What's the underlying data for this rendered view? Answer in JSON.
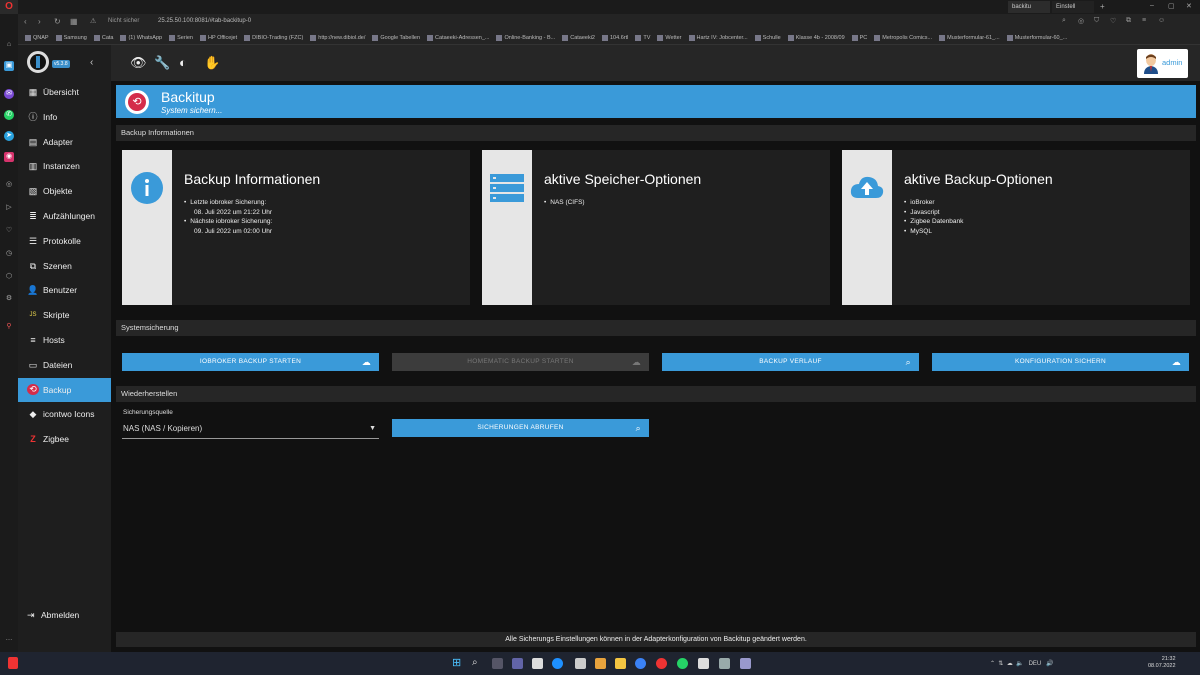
{
  "browser": {
    "tabs": [
      "backitu",
      "Einstell"
    ],
    "url_warning": "Nicht sicher",
    "url": "25.25.50.100:8081/#tab-backitup-0",
    "bookmarks": [
      "QNAP",
      "Samsung",
      "Cata",
      "(1) WhatsApp",
      "Serien",
      "HP Officejet",
      "DIBIO-Trading (FZC)",
      "http://new.dibiol.de/",
      "Google Tabellen",
      "Cataeeki-Adressen_...",
      "Online-Banking - B...",
      "Cataeeki2",
      "104.6rtl",
      "TV",
      "Wetter",
      "Hartz IV: Jobcenter...",
      "Schulle",
      "Klasse 4b - 2008/09",
      "PC",
      "Metropolis Comics...",
      "Musterformular-61_...",
      "Musterformular-60_..."
    ]
  },
  "app": {
    "version": "v5.3.8",
    "nav": [
      {
        "label": "Übersicht",
        "icon": "grid-icon"
      },
      {
        "label": "Info",
        "icon": "info-icon"
      },
      {
        "label": "Adapter",
        "icon": "adapter-icon"
      },
      {
        "label": "Instanzen",
        "icon": "instances-icon"
      },
      {
        "label": "Objekte",
        "icon": "objects-icon"
      },
      {
        "label": "Aufzählungen",
        "icon": "enums-icon"
      },
      {
        "label": "Protokolle",
        "icon": "logs-icon"
      },
      {
        "label": "Szenen",
        "icon": "scenes-icon"
      },
      {
        "label": "Benutzer",
        "icon": "users-icon"
      },
      {
        "label": "Skripte",
        "icon": "scripts-icon"
      },
      {
        "label": "Hosts",
        "icon": "hosts-icon"
      },
      {
        "label": "Dateien",
        "icon": "files-icon"
      },
      {
        "label": "Backup",
        "icon": "backup-icon"
      },
      {
        "label": "icontwo Icons",
        "icon": "icontwo-icon"
      },
      {
        "label": "Zigbee",
        "icon": "zigbee-icon"
      }
    ],
    "logout": "Abmelden",
    "user": "admin",
    "accent": "#3a9ad9"
  },
  "banner": {
    "title": "Backitup",
    "subtitle": "System sichern..."
  },
  "sections": {
    "info": "Backup Informationen",
    "system": "Systemsicherung",
    "restore": "Wiederherstellen"
  },
  "cards": [
    {
      "title": "Backup Informationen",
      "items": [
        {
          "label": "Letzte iobroker Sicherung:",
          "value": "08. Juli 2022 um 21:22 Uhr"
        },
        {
          "label": "Nächste iobroker Sicherung:",
          "value": "09. Juli 2022 um 02:00 Uhr"
        }
      ]
    },
    {
      "title": "aktive Speicher-Optionen",
      "items": [
        "NAS (CIFS)"
      ]
    },
    {
      "title": "aktive Backup-Optionen",
      "items": [
        "ioBroker",
        "Javascript",
        "Zigbee Datenbank",
        "MySQL"
      ]
    }
  ],
  "buttons": {
    "iobroker": "IOBROKER BACKUP STARTEN",
    "homematic": "HOMEMATIC BACKUP STARTEN",
    "history": "BACKUP VERLAUF",
    "config": "KONFIGURATION SICHERN",
    "fetch": "SICHERUNGEN ABRUFEN"
  },
  "restore": {
    "source_label": "Sicherungsquelle",
    "source_value": "NAS (NAS / Kopieren)"
  },
  "footer": "Alle Sicherungs Einstellungen können in der Adapterkonfiguration von Backitup geändert werden.",
  "taskbar": {
    "lang": "DEU",
    "time": "21:32",
    "date": "08.07.2022"
  }
}
